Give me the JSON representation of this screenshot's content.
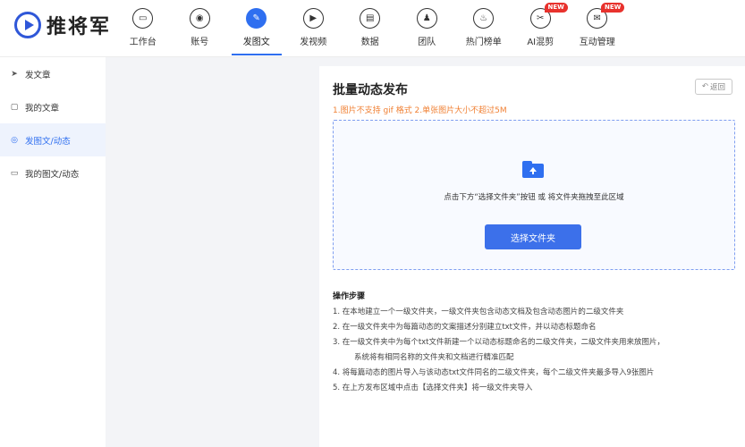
{
  "brand": {
    "name": "推将军"
  },
  "nav": [
    {
      "label": "工作台",
      "icon": "monitor-icon",
      "glyph": "▭"
    },
    {
      "label": "账号",
      "icon": "user-icon",
      "glyph": "◉"
    },
    {
      "label": "发图文",
      "icon": "feather-icon",
      "glyph": "✎",
      "active": true
    },
    {
      "label": "发视频",
      "icon": "play-icon",
      "glyph": "▶"
    },
    {
      "label": "数据",
      "icon": "chart-icon",
      "glyph": "▤"
    },
    {
      "label": "团队",
      "icon": "team-icon",
      "glyph": "♟"
    },
    {
      "label": "热门榜单",
      "icon": "fire-icon",
      "glyph": "♨"
    },
    {
      "label": "AI混剪",
      "icon": "ai-clip-icon",
      "glyph": "✂",
      "badge": "NEW"
    },
    {
      "label": "互动管理",
      "icon": "chat-icon",
      "glyph": "✉",
      "badge": "NEW"
    }
  ],
  "sidebar": [
    {
      "label": "发文章",
      "icon": "send-icon",
      "glyph": "➤"
    },
    {
      "label": "我的文章",
      "icon": "document-icon",
      "glyph": "▢"
    },
    {
      "label": "发图文/动态",
      "icon": "image-post-icon",
      "glyph": "◎",
      "active": true
    },
    {
      "label": "我的图文/动态",
      "icon": "list-icon",
      "glyph": "▭"
    }
  ],
  "main": {
    "title": "批量动态发布",
    "back_label": "返回",
    "note": "1.图片不支持 gif 格式 2.单张图片大小不超过5M",
    "drop_hint": "点击下方“选择文件夹”按钮 或 将文件夹拖拽至此区域",
    "choose_button": "选择文件夹",
    "steps_title": "操作步骤",
    "steps": [
      "1. 在本地建立一个一级文件夹，一级文件夹包含动态文档及包含动态图片的二级文件夹",
      "2. 在一级文件夹中为每篇动态的文案描述分别建立txt文件，并以动态标题命名",
      "3. 在一级文件夹中为每个txt文件新建一个以动态标题命名的二级文件夹，二级文件夹用来放图片，",
      "系统将有相同名称的文件夹和文档进行精准匹配",
      "4. 将每篇动态的图片导入与该动态txt文件同名的二级文件夹，每个二级文件夹最多导入9张图片",
      "5. 在上方发布区域中点击【选择文件夹】将一级文件夹导入"
    ]
  },
  "colors": {
    "accent": "#2f6ff0",
    "warning": "#f08034",
    "badge": "#e8322d"
  }
}
